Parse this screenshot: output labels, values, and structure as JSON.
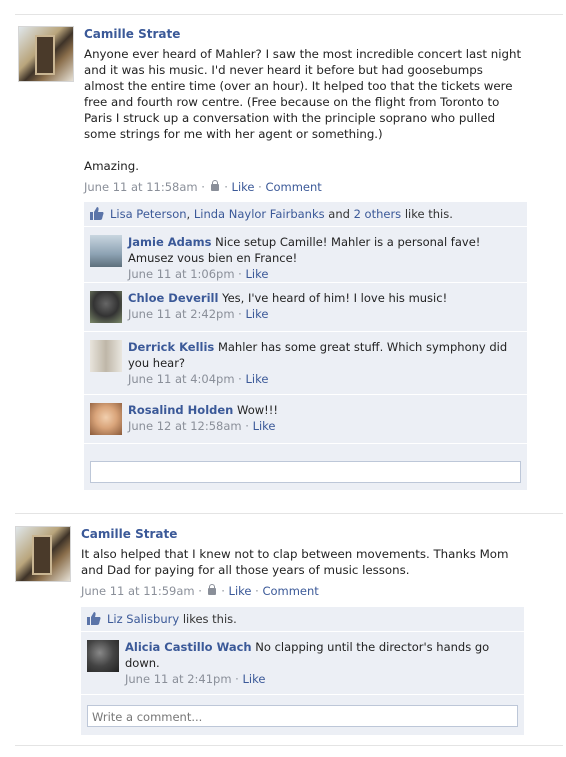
{
  "posts": [
    {
      "author": "Camille Strate",
      "text": "Anyone ever heard of Mahler? I saw the most incredible concert last night\nand it was his music. I'd never heard it before but had goosebumps\nalmost the entire time (over an hour). It helped too that the tickets were\nfree and fourth row centre. (Free because on the flight from Toronto to\nParis I struck up a conversation with the principle soprano who pulled\nsome strings for me with her agent or something.)\n\nAmazing.",
      "time": "June 11 at 11:58am",
      "like_label": "Like",
      "comment_label": "Comment",
      "likes": {
        "name1": "Lisa Peterson",
        "name2": "Linda Naylor Fairbanks",
        "and": "and",
        "others": "2 others",
        "suffix": "like this."
      },
      "comments": [
        {
          "name": "Jamie Adams",
          "text": "Nice setup Camille! Mahler is a personal fave! Amusez vous bien en France!",
          "time": "June 11 at 1:06pm",
          "like": "Like"
        },
        {
          "name": "Chloe Deverill",
          "text": "Yes, I've heard of him! I love his music!",
          "time": "June 11 at 2:42pm",
          "like": "Like"
        },
        {
          "name": "Derrick Kellis",
          "text": "Mahler has some great stuff. Which symphony did you hear?",
          "time": "June 11 at 4:04pm",
          "like": "Like"
        },
        {
          "name": "Rosalind Holden",
          "text": "Wow!!!",
          "time": "June 12 at 12:58am",
          "like": "Like"
        }
      ],
      "comment_placeholder": ""
    },
    {
      "author": "Camille Strate",
      "text": "It also helped that I knew not to clap between movements. Thanks Mom\nand Dad for paying for all those years of music lessons.",
      "time": "June 11 at 11:59am",
      "like_label": "Like",
      "comment_label": "Comment",
      "likes": {
        "name1": "Liz Salisbury",
        "suffix": "likes this."
      },
      "comments": [
        {
          "name": "Alicia Castillo Wach",
          "text": "No clapping until the director's hands go down.",
          "time": "June 11 at 2:41pm",
          "like": "Like"
        }
      ],
      "comment_placeholder": "Write a comment..."
    }
  ],
  "colors": {
    "link": "#3b5998",
    "meta": "#8a8f99",
    "ufi_bg": "#eceff5"
  }
}
